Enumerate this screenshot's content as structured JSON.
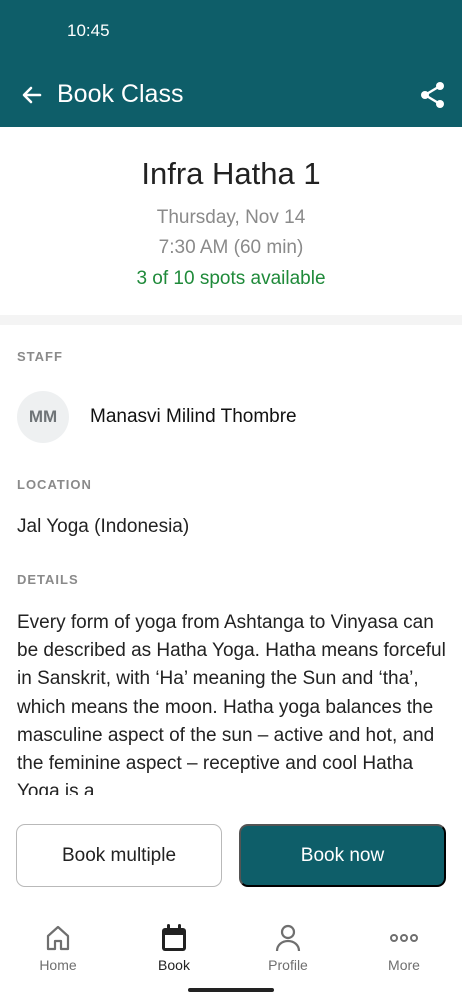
{
  "status_bar": {
    "time": "10:45"
  },
  "app_bar": {
    "title": "Book Class",
    "back_icon": "arrow-left-icon",
    "share_icon": "share-icon"
  },
  "class_info": {
    "name": "Infra Hatha 1",
    "date": "Thursday, Nov 14",
    "time": "7:30 AM (60 min)",
    "spots": "3 of 10 spots available"
  },
  "staff": {
    "label": "STAFF",
    "initials": "MM",
    "name": "Manasvi Milind Thombre"
  },
  "location": {
    "label": "LOCATION",
    "value": "Jal Yoga (Indonesia)"
  },
  "details": {
    "label": "DETAILS",
    "text": "Every form of yoga from Ashtanga to Vinyasa can be described as Hatha Yoga. Hatha means forceful in Sanskrit, with ‘Ha’ meaning the Sun and ‘tha’, which means the moon. Hatha yoga balances the masculine aspect of the sun – active and hot, and the feminine aspect – receptive and cool Hatha Yoga is a"
  },
  "actions": {
    "book_multiple": "Book multiple",
    "book_now": "Book now"
  },
  "bottom_nav": {
    "items": [
      {
        "label": "Home",
        "icon": "home-icon"
      },
      {
        "label": "Book",
        "icon": "calendar-icon",
        "active": true
      },
      {
        "label": "Profile",
        "icon": "person-icon"
      },
      {
        "label": "More",
        "icon": "more-dots-icon"
      }
    ]
  },
  "colors": {
    "primary": "#0e5e69",
    "available": "#1f8a3a",
    "muted": "#8a8a8a"
  }
}
